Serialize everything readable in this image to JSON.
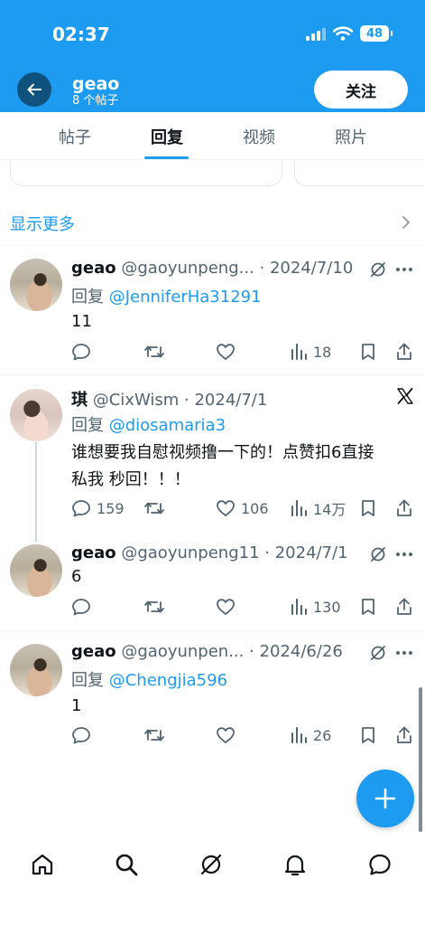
{
  "status_bar": {
    "time": "02:37",
    "battery": "48"
  },
  "header": {
    "name": "geao",
    "subtitle": "8 个帖子",
    "follow_label": "关注",
    "background_color": "#1d9bf0"
  },
  "tabs": [
    {
      "label": "帖子",
      "active": false
    },
    {
      "label": "回复",
      "active": true
    },
    {
      "label": "视频",
      "active": false
    },
    {
      "label": "照片",
      "active": false
    }
  ],
  "show_more": {
    "label": "显示更多"
  },
  "posts": [
    {
      "name": "geao",
      "handle": "@gaoyunpeng...",
      "dot": "·",
      "date": "2024/7/10",
      "reply_prefix": "回复 ",
      "reply_to": "@JenniferHa31291",
      "text": "11",
      "stats": {
        "replies": "",
        "reposts": "",
        "likes": "",
        "views": "18"
      }
    },
    {
      "name": "琪",
      "handle": "@CixWism",
      "dot": "·",
      "date": "2024/7/1",
      "reply_prefix": "回复 ",
      "reply_to": "@diosamaria3",
      "text_line1": "谁想要我自慰视频撸一下的！点赞扣6直接",
      "text_line2": "私我 秒回！！！",
      "stats": {
        "replies": "159",
        "reposts": "",
        "likes": "106",
        "views": "14万"
      }
    },
    {
      "name": "geao",
      "handle": "@gaoyunpeng11",
      "dot": "·",
      "date": "2024/7/1",
      "text": "6",
      "stats": {
        "replies": "",
        "reposts": "",
        "likes": "",
        "views": "130"
      }
    },
    {
      "name": "geao",
      "handle": "@gaoyunpen...",
      "dot": "·",
      "date": "2024/6/26",
      "reply_prefix": "回复 ",
      "reply_to": "@Chengjia596",
      "text": "1",
      "stats": {
        "replies": "",
        "reposts": "",
        "likes": "",
        "views": "26"
      }
    }
  ],
  "icons": {
    "back": "arrow-left-icon",
    "grok": "grok-icon",
    "more": "more-dots-icon",
    "x_logo": "x-logo-icon",
    "reply": "reply-icon",
    "repost": "repost-icon",
    "like": "heart-icon",
    "views": "views-icon",
    "bookmark": "bookmark-icon",
    "share": "share-icon",
    "compose": "plus-icon",
    "nav": [
      "home-icon",
      "search-icon",
      "grok-icon",
      "bell-icon",
      "messages-icon"
    ]
  },
  "colors": {
    "accent": "#1d9bf0",
    "text": "#0f1419",
    "secondary": "#536471"
  }
}
